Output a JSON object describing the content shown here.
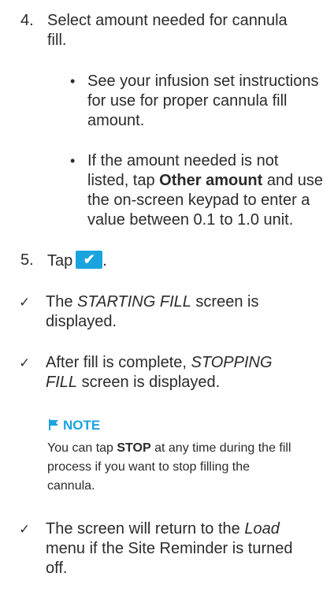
{
  "step4": {
    "number": "4.",
    "line1": "Select amount needed for cannula",
    "line2": "fill."
  },
  "bullet1": {
    "line1": "See your infusion set instructions",
    "line2": "for use for proper cannula fill",
    "line3": "amount."
  },
  "bullet2": {
    "line1": "If the amount needed is not",
    "line2_pre": "listed, tap ",
    "line2_bold": "Other amount",
    "line2_post": " and use",
    "line3": "the on-screen keypad to enter a",
    "line4": "value between 0.1 to 1.0 unit."
  },
  "step5": {
    "number": "5.",
    "text": "Tap",
    "button_glyph": "✔",
    "end": "."
  },
  "check1": {
    "mark": "✓",
    "pre": "The ",
    "italic": "STARTING FILL",
    "post": " screen is",
    "line2": "displayed."
  },
  "check2": {
    "mark": "✓",
    "line1_pre": "After fill is complete, ",
    "line1_italic": "STOPPING",
    "line2_italic": "FILL",
    "line2_post": " screen is displayed."
  },
  "note": {
    "title": "NOTE",
    "icon": "flag-icon",
    "line1_pre": "You can tap ",
    "line1_bold": "STOP",
    "line1_post": " at any time during the fill",
    "line2": "process if you want to stop filling the",
    "line3": "cannula."
  },
  "check3": {
    "mark": "✓",
    "line1_pre": "The screen will return to the ",
    "line1_italic": "Load",
    "line2": "menu if the Site Reminder is turned",
    "line3": "off."
  },
  "colors": {
    "accent": "#1aa3df",
    "text": "#2b2b2b"
  }
}
